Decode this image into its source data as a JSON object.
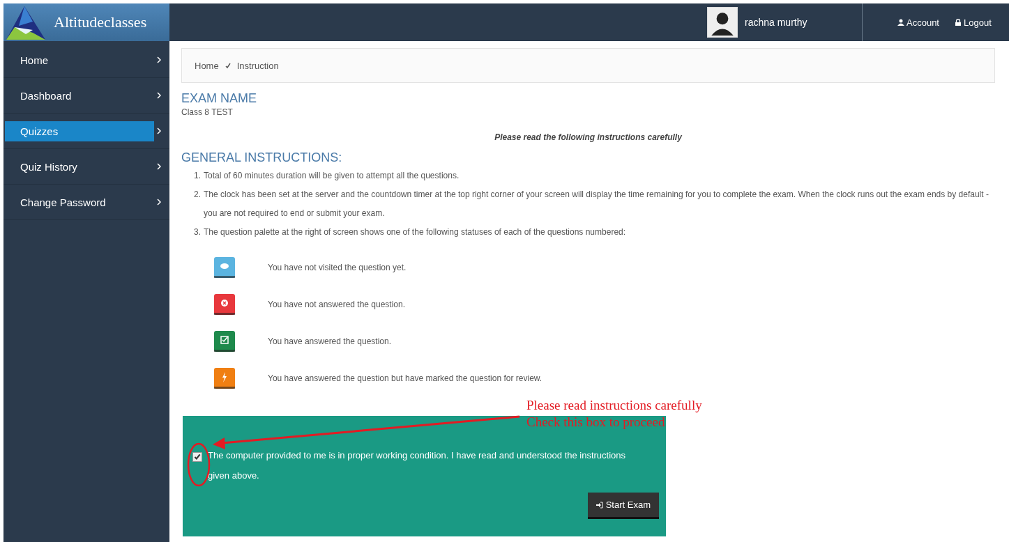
{
  "brand": {
    "name": "Altitudeclasses"
  },
  "user": {
    "name": "rachna murthy"
  },
  "header_links": [
    {
      "kind": "account",
      "label": "Account"
    },
    {
      "kind": "logout",
      "label": "Logout"
    }
  ],
  "sidebar": {
    "items": [
      {
        "label": "Home",
        "selected": false
      },
      {
        "label": "Dashboard",
        "selected": false
      },
      {
        "label": "Quizzes",
        "selected": true
      },
      {
        "label": "Quiz History",
        "selected": false
      },
      {
        "label": "Change Password",
        "selected": false
      }
    ]
  },
  "breadcrumb": [
    "Home",
    "Instruction"
  ],
  "exam": {
    "heading": "EXAM NAME",
    "name": "Class 8 TEST"
  },
  "notice": "Please read the following instructions carefully",
  "general": {
    "heading": "GENERAL INSTRUCTIONS:",
    "items": [
      {
        "number": "1.",
        "text": "Total of 60 minutes duration will be given to attempt all the questions."
      },
      {
        "number": "2.",
        "text": "The clock has been set at the server and the countdown timer at the top right corner of your screen will display the time remaining for you to complete the exam. When the clock runs out the exam ends by default - you are not required to end or submit your exam."
      },
      {
        "number": "3.",
        "text": "The question palette at the right of screen shows one of the following statuses of each of the questions numbered:"
      }
    ]
  },
  "legend": [
    {
      "kind": "eye",
      "color": "#5bb4e0",
      "text": "You have not visited the question yet."
    },
    {
      "kind": "cross",
      "color": "#e8383d",
      "text": "You have not answered the question."
    },
    {
      "kind": "check",
      "color": "#1e8a4c",
      "text": "You have answered the question."
    },
    {
      "kind": "bolt",
      "color": "#f07f12",
      "text": "You have answered the question but have marked the question for review."
    }
  ],
  "agreement": {
    "checked": true,
    "text": "The computer provided to me is in proper working condition. I have read and understood the instructions given above.",
    "button": "Start Exam"
  },
  "annotation": {
    "lines": [
      "Please read instructions carefully",
      "Check this box to proceed"
    ]
  }
}
